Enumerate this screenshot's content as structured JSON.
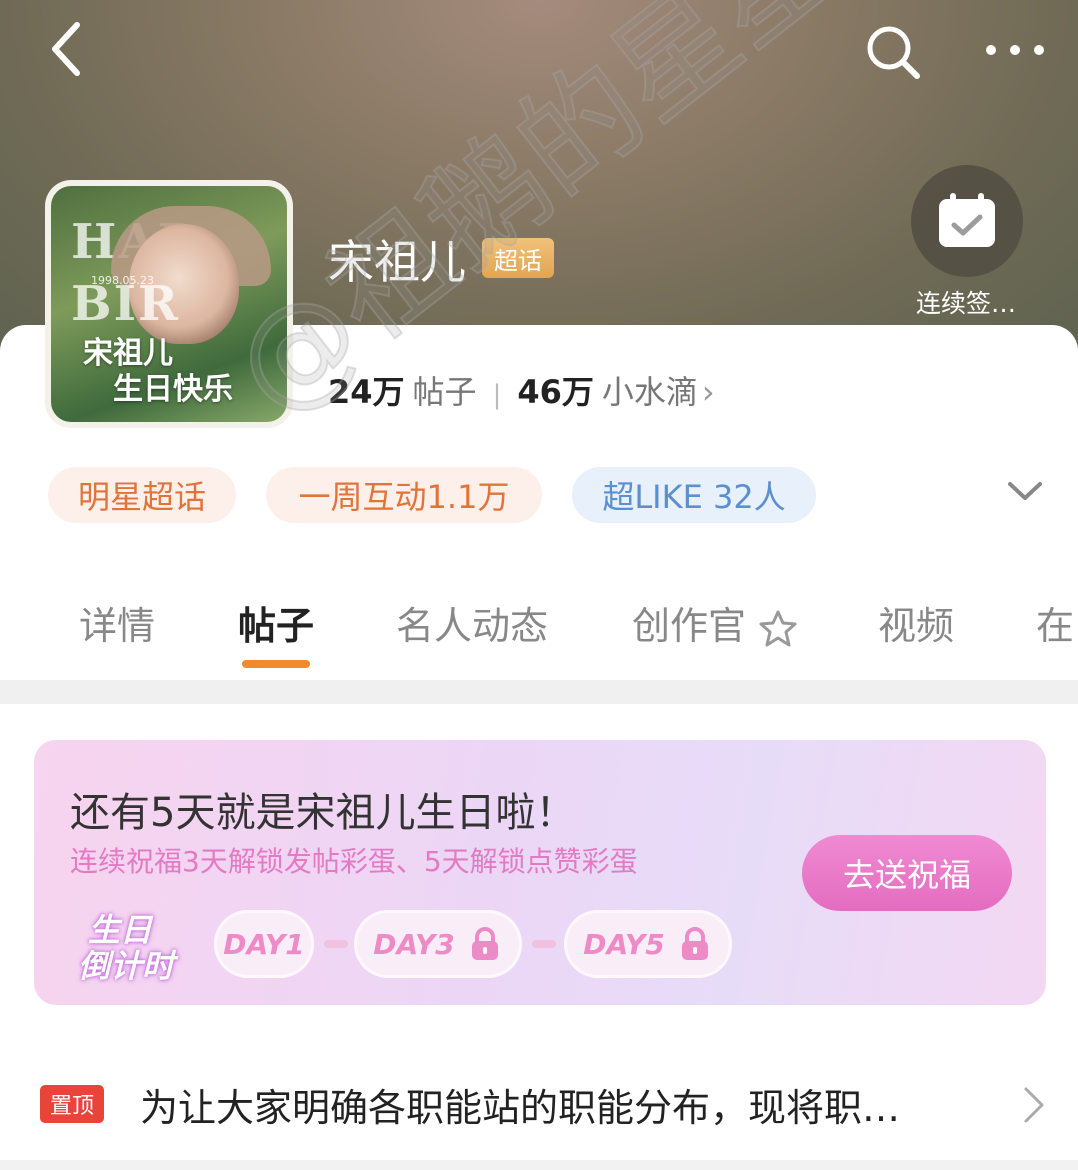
{
  "header": {
    "back_icon": "back-arrow-icon",
    "search_icon": "search-icon",
    "more_icon": "more-dots-icon"
  },
  "profile": {
    "avatar_top_text1": "HAP",
    "avatar_top_text2": "BIR",
    "avatar_date": "1998.05.23",
    "avatar_title_line1": "宋祖儿",
    "avatar_title_line2": "生日快乐",
    "name": "宋祖儿",
    "badge": "超话",
    "checkin_label": "连续签…",
    "checkin_icon": "calendar-check-icon"
  },
  "stats": {
    "posts_num": "24万",
    "posts_label": "帖子",
    "drops_num": "46万",
    "drops_label": "小水滴",
    "chevron": "›"
  },
  "tags": [
    "明星超话",
    "一周互动1.1万",
    "超LIKE 32人"
  ],
  "tabs": [
    "详情",
    "帖子",
    "名人动态",
    "创作官",
    "视频",
    "在"
  ],
  "active_tab": "帖子",
  "banner": {
    "title": "还有5天就是宋祖儿生日啦！",
    "subtitle": "连续祝福3天解锁发帖彩蛋、5天解锁点赞彩蛋",
    "button": "去送祝福",
    "logo_line1": "生日",
    "logo_line2": "倒计时",
    "days": [
      "DAY1",
      "DAY3",
      "DAY5"
    ]
  },
  "pinned": {
    "badge": "置顶",
    "text": "为让大家明确各职能站的职能分布，现将职…"
  },
  "watermark": "@祖鹅的星星眼",
  "colors": {
    "accent_orange": "#f08a2c",
    "tag_orange": "#e0743a",
    "tag_blue": "#5a8fd0",
    "pink": "#e46cc0",
    "pin_red": "#e8443a"
  }
}
